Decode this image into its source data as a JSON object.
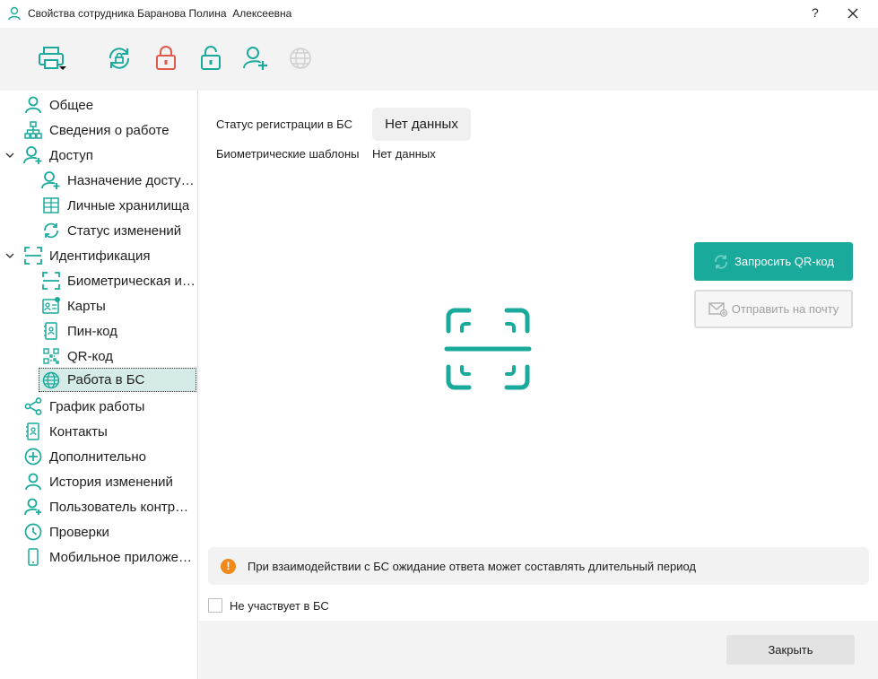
{
  "window": {
    "title": "Свойства сотрудника Баранова Полина  Алексеевна",
    "help_label": "?"
  },
  "toolbar": {
    "icons": [
      "printer-icon",
      "sync-lock-icon",
      "lock-closed-icon",
      "lock-open-icon",
      "add-user-icon",
      "globe-icon"
    ]
  },
  "sidebar": {
    "items": [
      {
        "label": "Общее",
        "icon": "user-icon"
      },
      {
        "label": "Сведения о работе",
        "icon": "org-chart-icon"
      },
      {
        "label": "Доступ",
        "icon": "user-access-icon",
        "expanded": true
      },
      {
        "label": "Назначение доступа",
        "icon": "user-assign-icon"
      },
      {
        "label": "Личные хранилища",
        "icon": "storage-icon"
      },
      {
        "label": "Статус изменений",
        "icon": "refresh-icon"
      },
      {
        "label": "Идентификация",
        "icon": "scan-frame-icon",
        "expanded": true
      },
      {
        "label": "Биометрическая идентификация",
        "icon": "scan-frame-icon"
      },
      {
        "label": "Карты",
        "icon": "card-icon"
      },
      {
        "label": "Пин-код",
        "icon": "pin-icon"
      },
      {
        "label": "QR-код",
        "icon": "qr-icon"
      },
      {
        "label": "Работа в БС",
        "icon": "globe-icon",
        "selected": true
      },
      {
        "label": "График работы",
        "icon": "share-icon"
      },
      {
        "label": "Контакты",
        "icon": "contacts-icon"
      },
      {
        "label": "Дополнительно",
        "icon": "plus-circle-icon"
      },
      {
        "label": "История изменений",
        "icon": "user-icon"
      },
      {
        "label": "Пользователь контроллера",
        "icon": "user-controller-icon"
      },
      {
        "label": "Проверки",
        "icon": "clock-icon"
      },
      {
        "label": "Мобильное приложение",
        "icon": "mobile-icon"
      }
    ]
  },
  "main": {
    "status_label": "Статус регистрации в БС",
    "status_value": "Нет данных",
    "biometric_label": "Биометрические шаблоны",
    "biometric_value": "Нет данных",
    "request_qr_label": "Запросить QR-код",
    "send_mail_label": "Отправить на почту",
    "notice_text": "При взаимодействии с БС ожидание ответа может составлять длительный период",
    "not_participating_label": "Не участвует в БС",
    "not_participating_checked": false
  },
  "footer": {
    "close_label": "Закрыть"
  },
  "colors": {
    "accent": "#1aaa9c",
    "lock_red": "#e05a4a",
    "warning": "#f08a1c",
    "selection": "#d4ebe7"
  }
}
